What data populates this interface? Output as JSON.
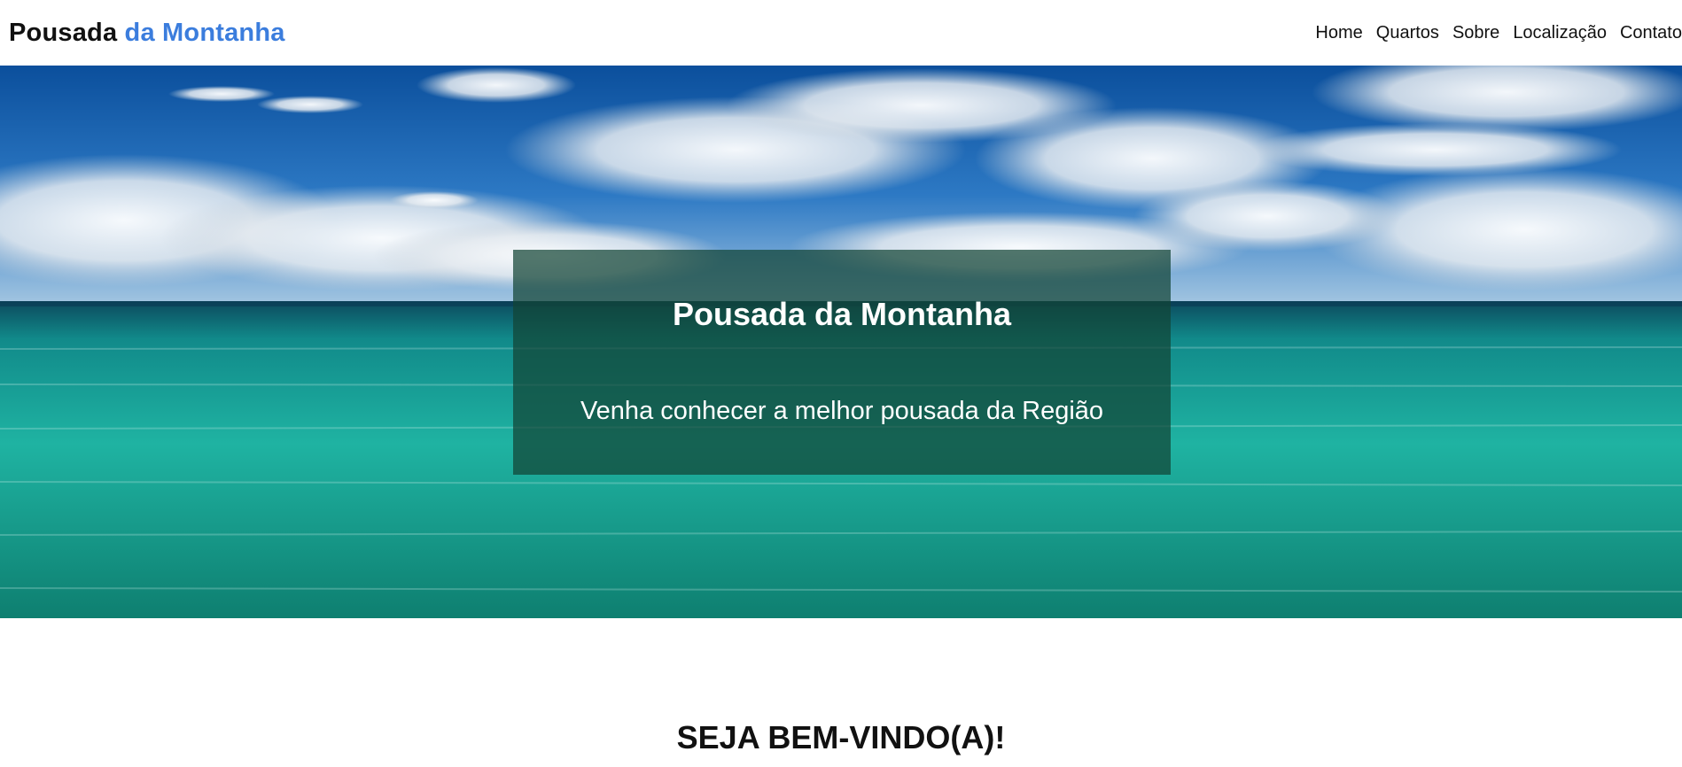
{
  "header": {
    "brand_part1": "Pousada",
    "brand_part2": "da Montanha",
    "nav": [
      "Home",
      "Quartos",
      "Sobre",
      "Localização",
      "Contato"
    ]
  },
  "hero": {
    "image": "ocean-sky-clouds-photo",
    "title": "Pousada da Montanha",
    "subtitle": "Venha conhecer a melhor pousada da Região"
  },
  "welcome": {
    "heading": "SEJA BEM-VINDO(A)!"
  },
  "colors": {
    "brand_accent": "#3b7ddd",
    "text": "#111111",
    "overlay": "#124434"
  }
}
